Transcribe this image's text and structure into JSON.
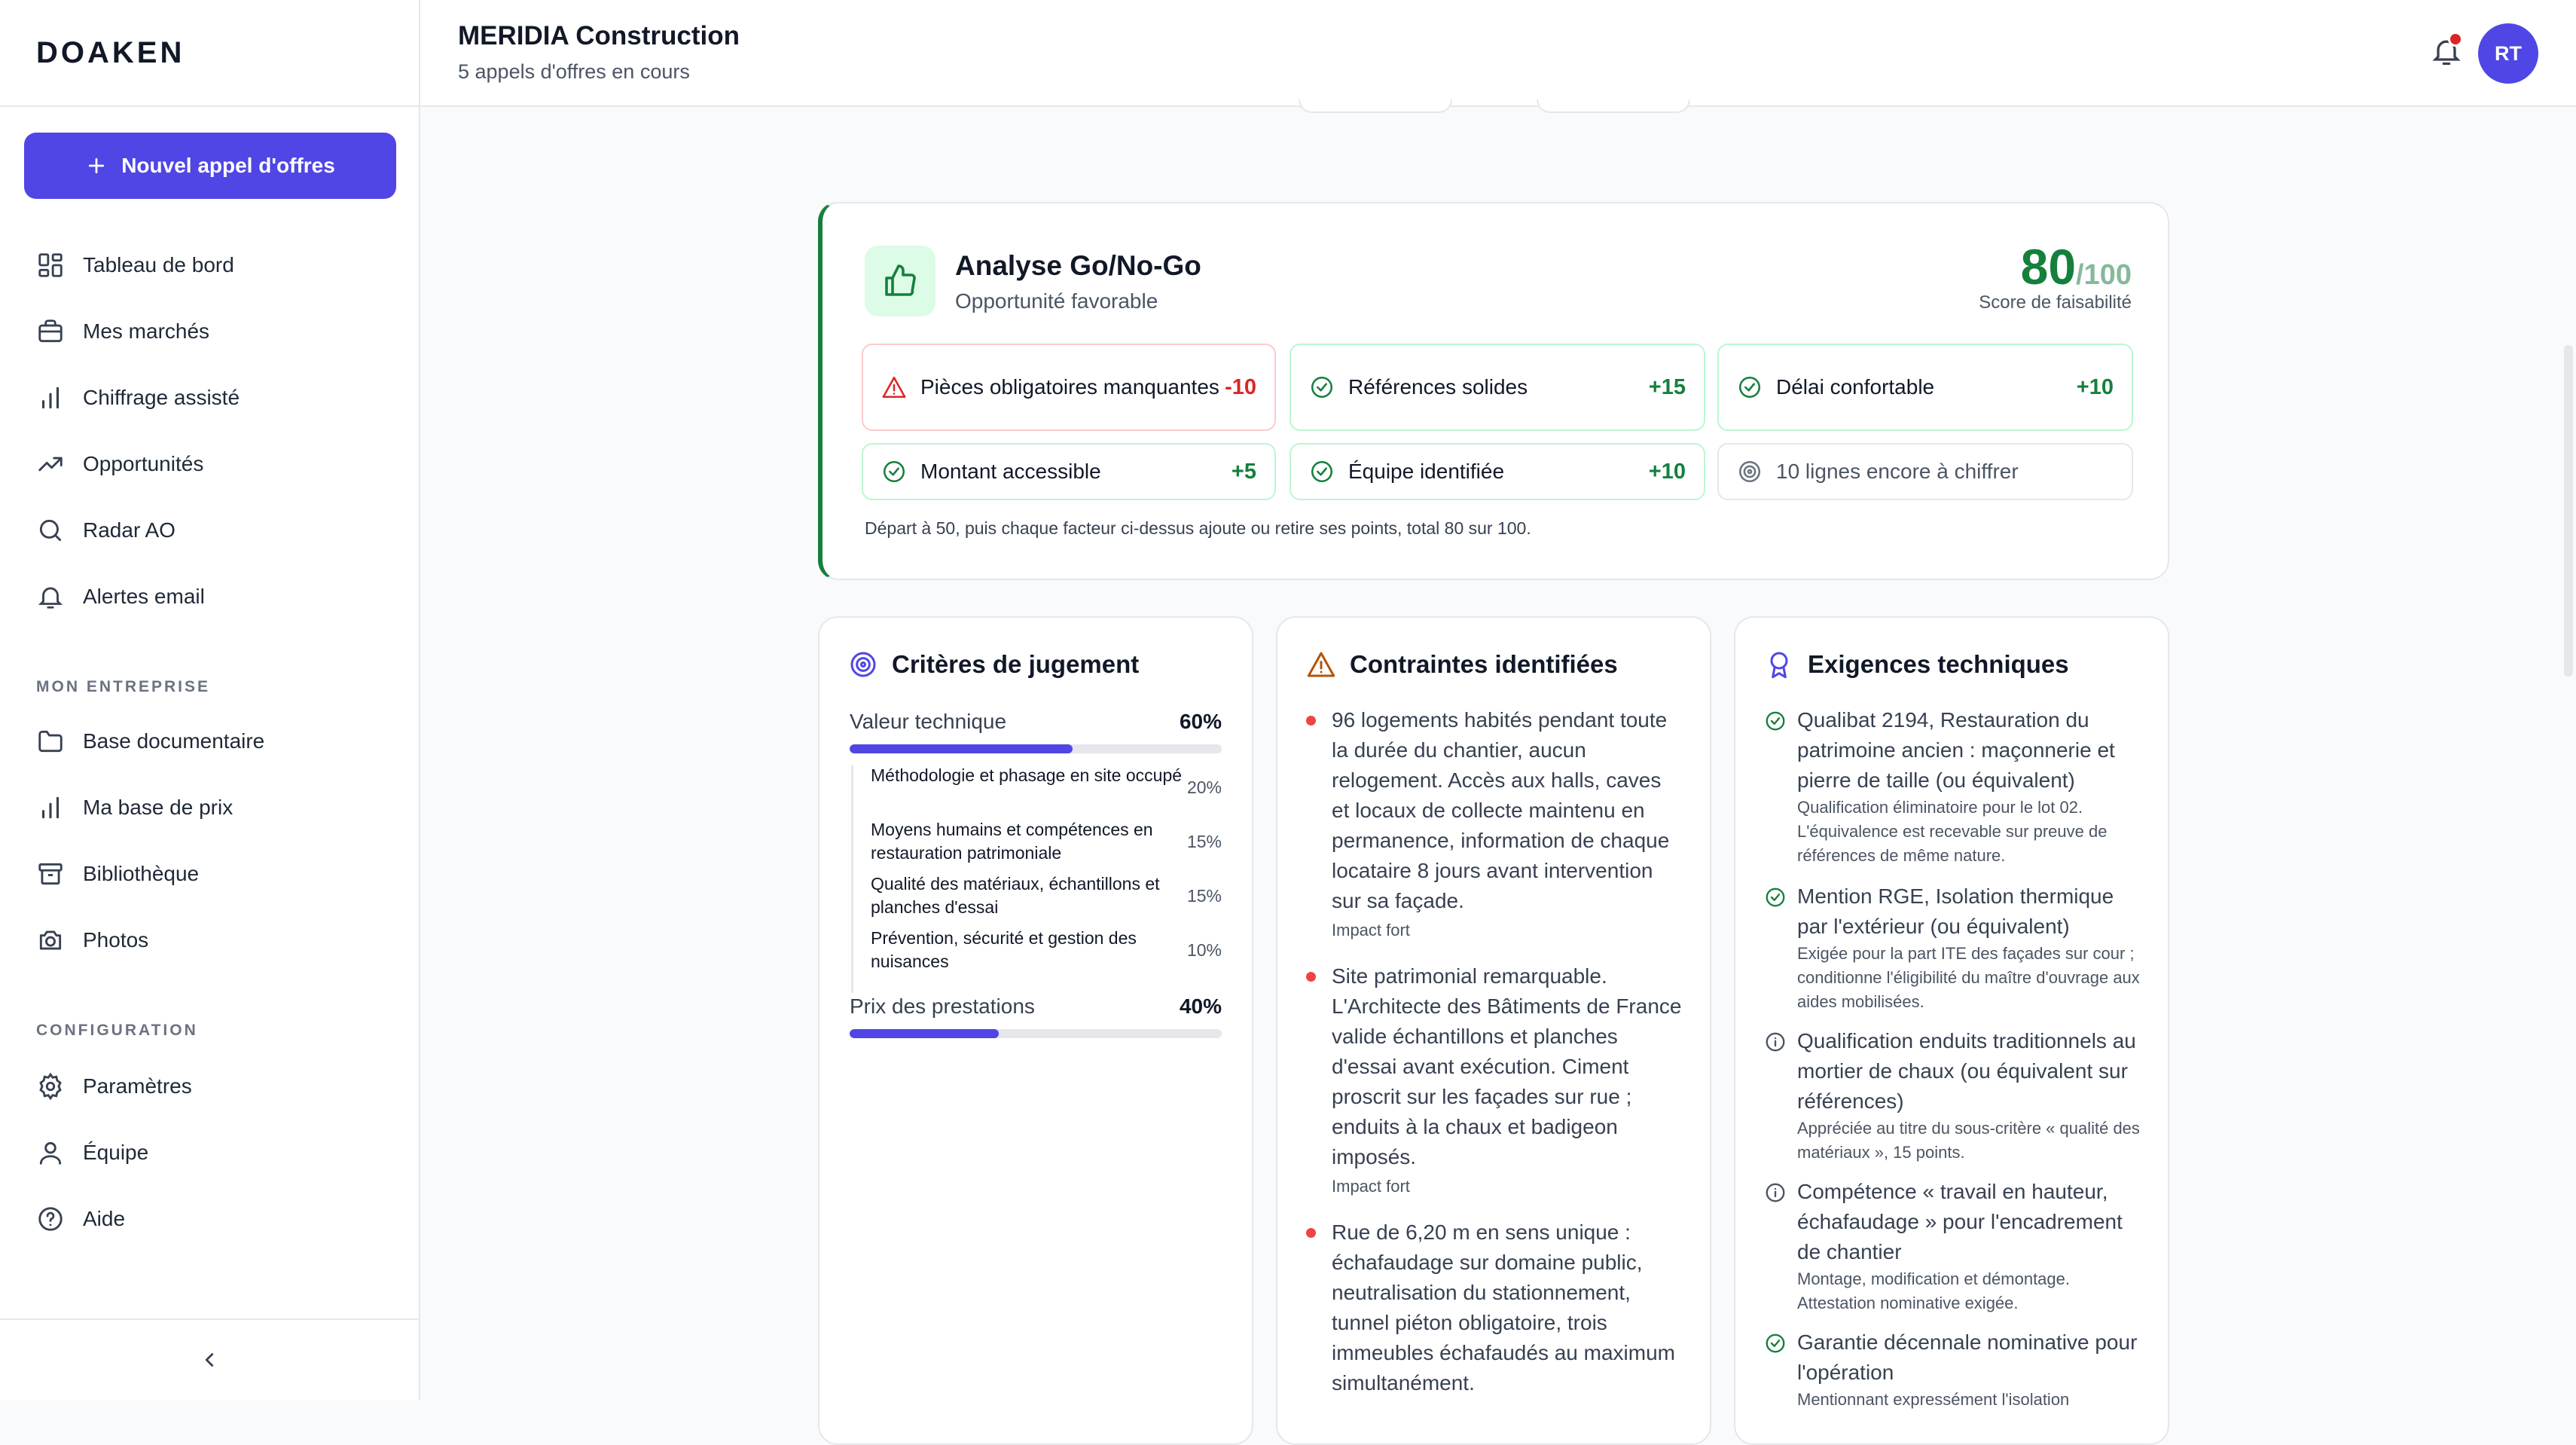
{
  "app": {
    "logo": "DOAKEN"
  },
  "sidebar": {
    "new_button": "Nouvel appel d'offres",
    "items": [
      {
        "label": "Tableau de bord",
        "icon": "dashboard-icon"
      },
      {
        "label": "Mes marchés",
        "icon": "briefcase-icon"
      },
      {
        "label": "Chiffrage assisté",
        "icon": "bar-chart-icon"
      },
      {
        "label": "Opportunités",
        "icon": "trending-up-icon"
      },
      {
        "label": "Radar AO",
        "icon": "search-icon"
      },
      {
        "label": "Alertes email",
        "icon": "bell-icon"
      }
    ],
    "section_company": "MON ENTREPRISE",
    "company_items": [
      {
        "label": "Base documentaire",
        "icon": "folder-icon"
      },
      {
        "label": "Ma base de prix",
        "icon": "bar-chart-icon"
      },
      {
        "label": "Bibliothèque",
        "icon": "archive-icon"
      },
      {
        "label": "Photos",
        "icon": "camera-icon"
      }
    ],
    "section_config": "CONFIGURATION",
    "config_items": [
      {
        "label": "Paramètres",
        "icon": "gear-icon"
      },
      {
        "label": "Équipe",
        "icon": "user-icon"
      },
      {
        "label": "Aide",
        "icon": "help-circle-icon"
      }
    ]
  },
  "header": {
    "company": "MERIDIA Construction",
    "subtitle": "5 appels d'offres en cours",
    "avatar_initials": "RT",
    "has_notification": true
  },
  "gonogo": {
    "title": "Analyse Go/No-Go",
    "subtitle": "Opportunité favorable",
    "score": "80",
    "score_max": "/100",
    "score_label": "Score de faisabilité",
    "factors": [
      {
        "label": "Pièces obligatoires manquantes",
        "points": "-10",
        "kind": "negative"
      },
      {
        "label": "Références solides",
        "points": "+15",
        "kind": "positive"
      },
      {
        "label": "Délai confortable",
        "points": "+10",
        "kind": "positive"
      },
      {
        "label": "Montant accessible",
        "points": "+5",
        "kind": "positive"
      },
      {
        "label": "Équipe identifiée",
        "points": "+10",
        "kind": "positive"
      },
      {
        "label": "10 lignes encore à chiffrer",
        "points": "",
        "kind": "neutral"
      }
    ],
    "note": "Départ à 50, puis chaque facteur ci-dessus ajoute ou retire ses points, total 80 sur 100."
  },
  "criteria": {
    "title": "Critères de jugement",
    "main": [
      {
        "label": "Valeur technique",
        "pct": "60%",
        "value": 0.6
      },
      {
        "label": "Prix des prestations",
        "pct": "40%",
        "value": 0.4
      }
    ],
    "sub": [
      {
        "label": "Méthodologie et phasage en site occupé",
        "pct": "20%"
      },
      {
        "label": "Moyens humains et compétences en restauration patrimoniale",
        "pct": "15%"
      },
      {
        "label": "Qualité des matériaux, échantillons et planches d'essai",
        "pct": "15%"
      },
      {
        "label": "Prévention, sécurité et gestion des nuisances",
        "pct": "10%"
      }
    ]
  },
  "constraints": {
    "title": "Contraintes identifiées",
    "items": [
      {
        "text": "96 logements habités pendant toute la durée du chantier, aucun relogement. Accès aux halls, caves et locaux de collecte maintenu en permanence, information de chaque locataire 8 jours avant intervention sur sa façade.",
        "impact": "Impact fort"
      },
      {
        "text": "Site patrimonial remarquable. L'Architecte des Bâtiments de France valide échantillons et planches d'essai avant exécution. Ciment proscrit sur les façades sur rue ; enduits à la chaux et badigeon imposés.",
        "impact": "Impact fort"
      },
      {
        "text": "Rue de 6,20 m en sens unique : échafaudage sur domaine public, neutralisation du stationnement, tunnel piéton obligatoire, trois immeubles échafaudés au maximum simultanément.",
        "impact": ""
      }
    ]
  },
  "requirements": {
    "title": "Exigences techniques",
    "items": [
      {
        "status": "check",
        "text": "Qualibat 2194, Restauration du patrimoine ancien : maçonnerie et pierre de taille (ou équivalent)",
        "detail": "Qualification éliminatoire pour le lot 02. L'équivalence est recevable sur preuve de références de même nature."
      },
      {
        "status": "check",
        "text": "Mention RGE, Isolation thermique par l'extérieur (ou équivalent)",
        "detail": "Exigée pour la part ITE des façades sur cour ; conditionne l'éligibilité du maître d'ouvrage aux aides mobilisées."
      },
      {
        "status": "info",
        "text": "Qualification enduits traditionnels au mortier de chaux (ou équivalent sur références)",
        "detail": "Appréciée au titre du sous-critère « qualité des matériaux », 15 points."
      },
      {
        "status": "info",
        "text": "Compétence « travail en hauteur, échafaudage » pour l'encadrement de chantier",
        "detail": "Montage, modification et démontage. Attestation nominative exigée."
      },
      {
        "status": "check",
        "text": "Garantie décennale nominative pour l'opération",
        "detail": "Mentionnant expressément l'isolation"
      }
    ]
  },
  "colors": {
    "accent": "#4f46e5",
    "positive": "#15803d",
    "negative": "#dc2626",
    "notification": "#dc2626"
  }
}
